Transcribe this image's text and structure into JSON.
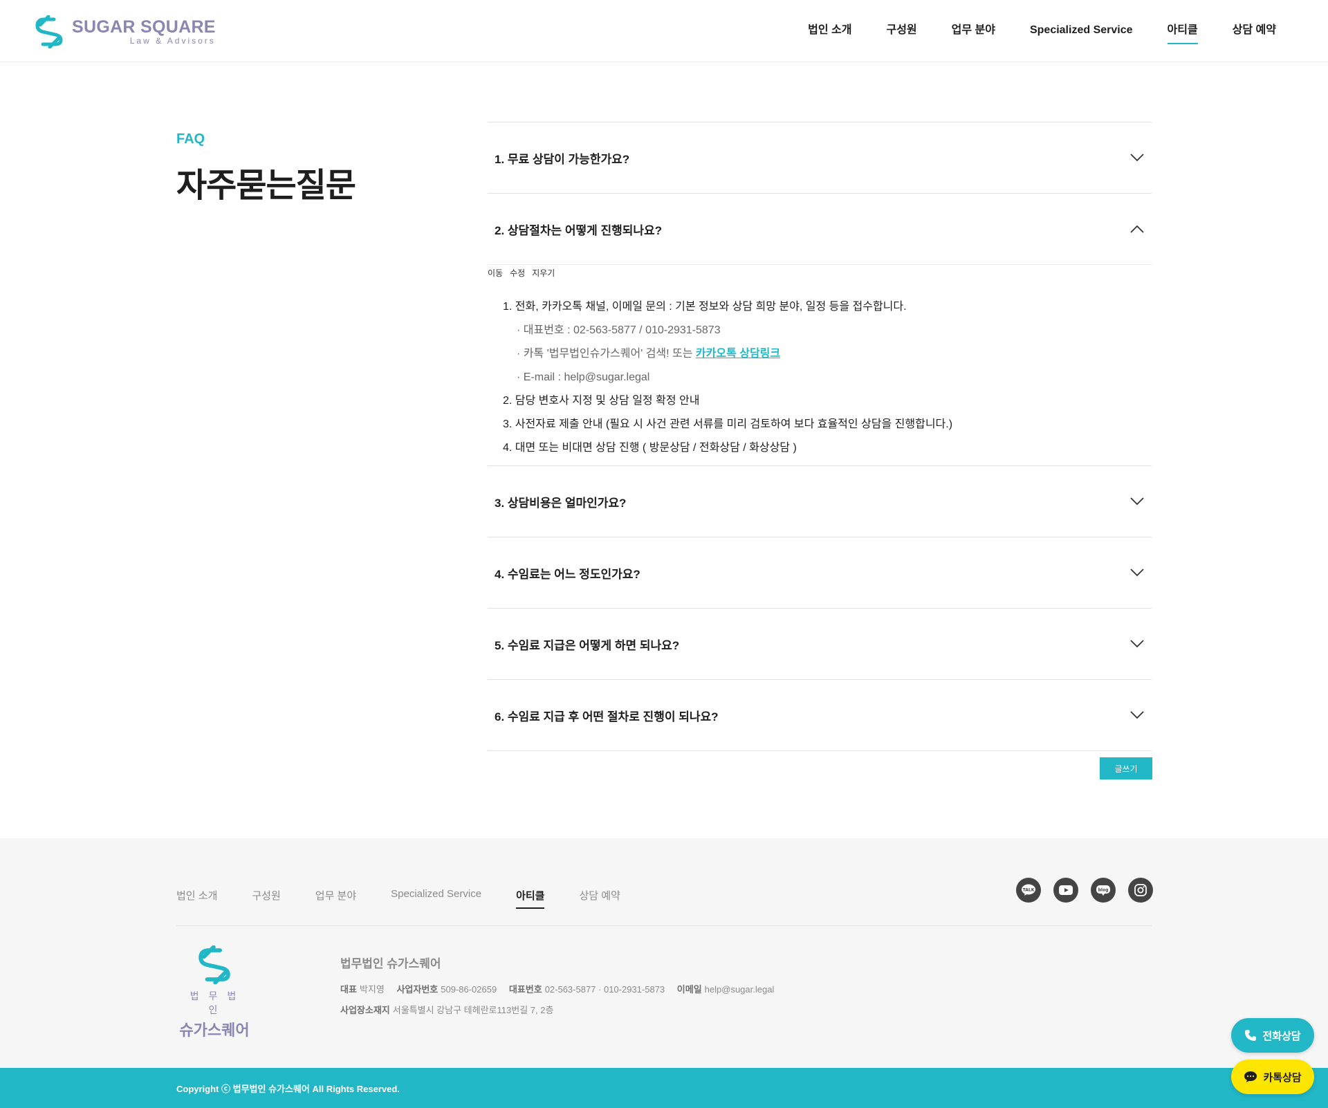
{
  "header": {
    "logo_title": "SUGAR SQUARE",
    "logo_sub": "Law & Advisors",
    "nav": [
      {
        "label": "법인 소개"
      },
      {
        "label": "구성원"
      },
      {
        "label": "업무 분야"
      },
      {
        "label": "Specialized Service"
      },
      {
        "label": "아티클",
        "active": true
      },
      {
        "label": "상담 예약"
      }
    ]
  },
  "heading": {
    "label": "FAQ",
    "title": "자주묻는질문"
  },
  "faq": {
    "items": [
      {
        "question": "1. 무료 상담이 가능한가요?",
        "expanded": false
      },
      {
        "question": "2. 상담절차는 어떻게 진행되나요?",
        "expanded": true
      },
      {
        "question": "3. 상담비용은 얼마인가요?",
        "expanded": false
      },
      {
        "question": "4. 수임료는 어느 정도인가요?",
        "expanded": false
      },
      {
        "question": "5. 수임료 지급은 어떻게 하면 되나요?",
        "expanded": false
      },
      {
        "question": "6. 수임료 지급 후 어떤 절차로 진행이 되나요?",
        "expanded": false
      }
    ],
    "edit_tools": {
      "move": "이동",
      "edit": "수정",
      "delete": "지우기"
    },
    "answer": {
      "step1": "1. 전화, 카카오톡 채널, 이메일 문의 : 기본 정보와 상담 희망 분야, 일정 등을 접수합니다.",
      "phone": "· 대표번호 : 02-563-5877 / 010-2931-5873",
      "kakao_prefix": "· 카톡 '법무법인슈가스퀘어' 검색! 또는 ",
      "kakao_link": "카카오톡 상담링크",
      "email": "· E-mail : help@sugar.legal",
      "step2": "2. 담당 변호사 지정 및 상담 일정 확정 안내",
      "step3": "3. 사전자료 제출 안내 (필요 시 사건 관련 서류를 미리 검토하여 보다 효율적인 상담을 진행합니다.)",
      "step4": "4. 대면 또는 비대면 상담 진행 ( 방문상담 / 전화상담 / 화상상담 )"
    },
    "write_button": "글쓰기"
  },
  "footer": {
    "nav": [
      {
        "label": "법인 소개"
      },
      {
        "label": "구성원"
      },
      {
        "label": "업무 분야"
      },
      {
        "label": "Specialized Service"
      },
      {
        "label": "아티클",
        "active": true
      },
      {
        "label": "상담 예약"
      }
    ],
    "socials": [
      {
        "icon": "kakao-talk-icon",
        "text": "TALK"
      },
      {
        "icon": "youtube-icon"
      },
      {
        "icon": "blog-icon",
        "text": "blog"
      },
      {
        "icon": "instagram-icon"
      }
    ],
    "logo_small": "법무법인",
    "logo_big": "슈가스퀘어",
    "company": "법무법인 슈가스퀘어",
    "ceo_label": "대표",
    "ceo": "박지영",
    "biz_label": "사업자번호",
    "biz": "509-86-02659",
    "tel_label": "대표번호",
    "tel": "02-563-5877 · 010-2931-5873",
    "email_label": "이메일",
    "email": "help@sugar.legal",
    "addr_label": "사업장소재지",
    "addr": "서울특별시 강남구 테헤란로113번길 7, 2층",
    "copyright": "Copyright ⓒ 법무법인 슈가스퀘어 All Rights Reserved."
  },
  "floating": {
    "call": "전화상담",
    "kakao": "카톡상담"
  },
  "colors": {
    "accent": "#22b7c6",
    "logo": "#8a86b2",
    "kakao": "#fee500"
  }
}
